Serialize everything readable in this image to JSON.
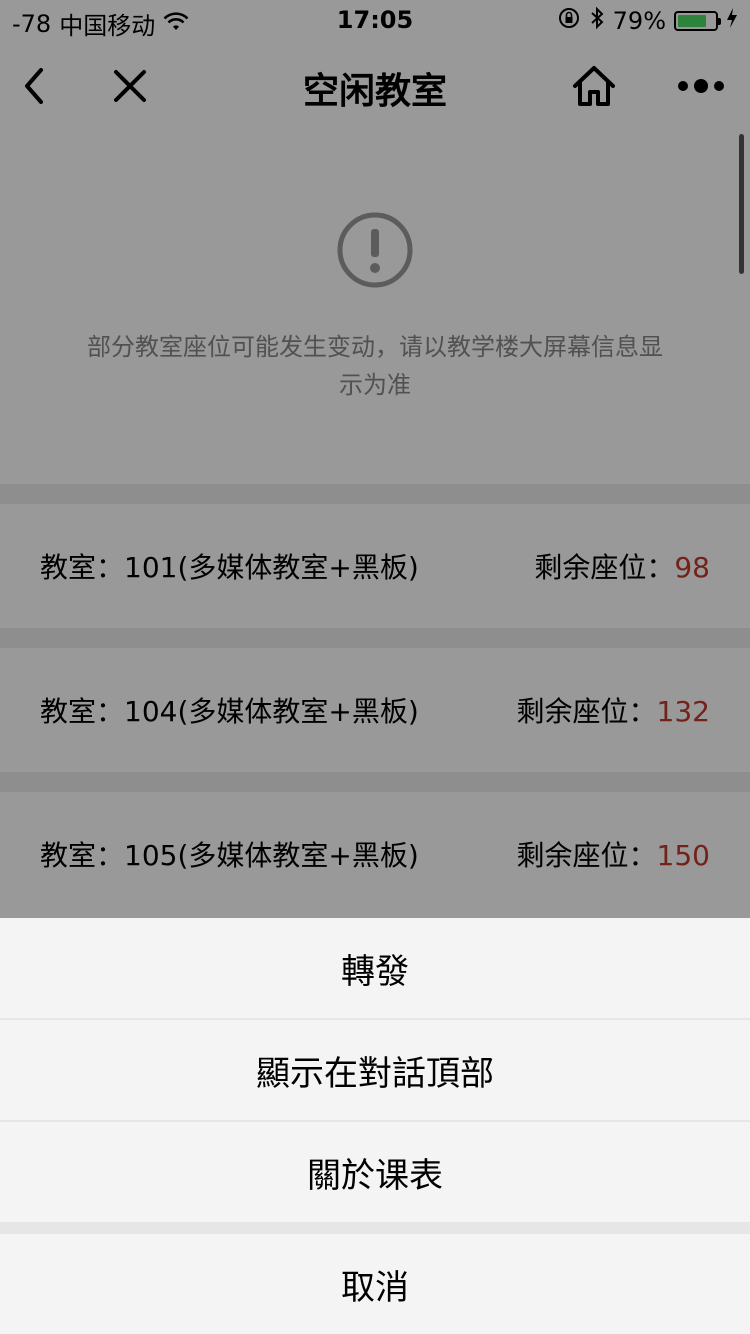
{
  "status_bar": {
    "signal": "-78",
    "carrier": "中国移动",
    "time": "17:05",
    "battery": "79%",
    "battery_level": 0.79,
    "icons": [
      "wifi-icon",
      "rotation-lock-icon",
      "bluetooth-icon",
      "battery-icon",
      "charging-icon"
    ]
  },
  "nav": {
    "title": "空闲教室",
    "icons": [
      "back-icon",
      "close-icon",
      "home-icon",
      "more-icon"
    ]
  },
  "notice": {
    "icon": "exclamation-circle-icon",
    "text": "部分教室座位可能发生变动，请以教学楼大屏幕信息显示为准"
  },
  "rooms": [
    {
      "name": "教室：101(多媒体教室+黑板)",
      "seat_label": "剩余座位：",
      "seats": "98"
    },
    {
      "name": "教室：104(多媒体教室+黑板)",
      "seat_label": "剩余座位：",
      "seats": "132"
    },
    {
      "name": "教室：105(多媒体教室+黑板)",
      "seat_label": "剩余座位：",
      "seats": "150"
    }
  ],
  "action_sheet": {
    "items": [
      "轉發",
      "顯示在對話頂部",
      "關於课表"
    ],
    "cancel": "取消"
  },
  "colors": {
    "seat_count": "#c0392b",
    "battery_fill": "#4cd964",
    "mask": "rgba(0,0,0,0.4)"
  }
}
